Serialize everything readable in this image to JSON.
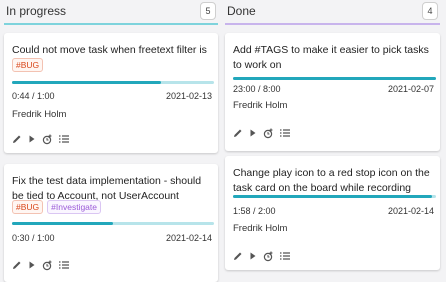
{
  "columns": [
    {
      "title": "In progress",
      "count": "5",
      "cards": [
        {
          "title": "Could not move task when freetext filter is active",
          "tags": [
            "#BUG"
          ],
          "progress": 0.74,
          "time": "0:44 / 1:00",
          "date": "2021-02-13",
          "assignee": "Fredrik Holm"
        },
        {
          "title": "Fix the test data implementation - should be tied to Account, not UserAccount",
          "tags": [
            "#BUG",
            "#Investigate"
          ],
          "progress": 0.5,
          "time": "0:30 / 1:00",
          "date": "2021-02-14",
          "assignee": ""
        }
      ]
    },
    {
      "title": "Done",
      "count": "4",
      "cards": [
        {
          "title": "Add #TAGS to make it easier to pick tasks to work on",
          "tags": [],
          "progress": 1.0,
          "time": "23:00 / 8:00",
          "date": "2021-02-07",
          "assignee": "Fredrik Holm"
        },
        {
          "title": "Change play icon to a red stop icon on the task card on the board while recording",
          "tags": [],
          "progress": 0.98,
          "time": "1:58 / 2:00",
          "date": "2021-02-14",
          "assignee": "Fredrik Holm"
        }
      ]
    }
  ],
  "icons": [
    "edit-icon",
    "play-icon",
    "add-time-icon",
    "list-icon"
  ],
  "colors": {
    "progress_fill": "#22a7bb",
    "progress_track": "#b7e4ea",
    "in_progress_underline": "#7ed3dc",
    "done_underline": "#c8b4ec",
    "bug_tag": "#d9481c",
    "investigate_tag": "#9b5bd8"
  }
}
